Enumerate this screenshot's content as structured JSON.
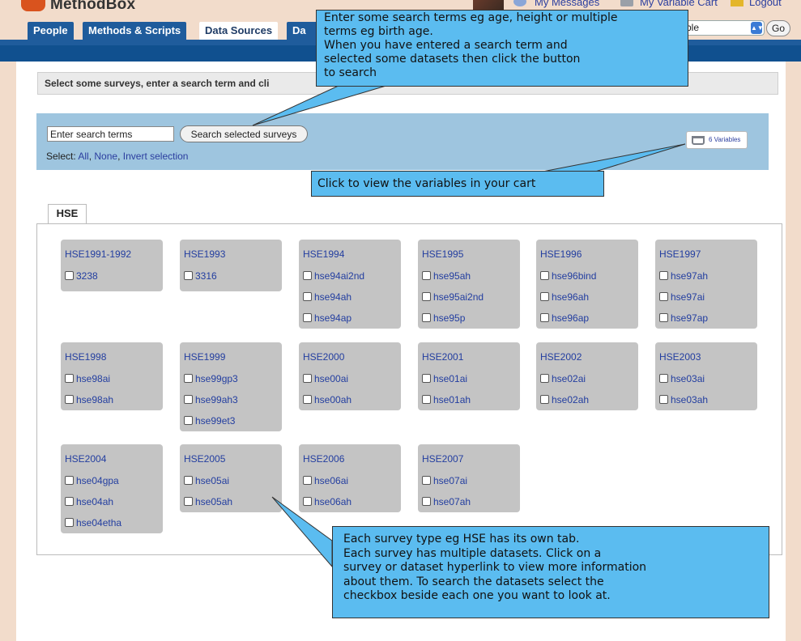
{
  "header": {
    "brand": "MethodBox",
    "links": {
      "messages": "My Messages",
      "variable_cart": "My Variable Cart",
      "logout": "Logout"
    },
    "nav_tabs": [
      {
        "label": "People"
      },
      {
        "label": "Methods & Scripts"
      },
      {
        "label": "Data Sources"
      },
      {
        "label": "Da"
      }
    ],
    "active_tab": "Data Sources",
    "search_scope_value": "ble",
    "go_label": "Go"
  },
  "content": {
    "instruction": "Select some surveys, enter a search term and cli",
    "search": {
      "value": "Enter search terms",
      "button_label": "Search selected surveys"
    },
    "select": {
      "prefix": "Select:",
      "all": "All",
      "sep1": ",",
      "none": "None",
      "sep2": ",",
      "invert": "Invert selection"
    },
    "cart_button_label": "6 Variables",
    "survey_tab": "HSE"
  },
  "surveys": [
    {
      "title": "HSE1991-1992",
      "datasets": [
        "3238"
      ]
    },
    {
      "title": "HSE1993",
      "datasets": [
        "3316"
      ]
    },
    {
      "title": "HSE1994",
      "datasets": [
        "hse94ai2nd",
        "hse94ah",
        "hse94ap"
      ]
    },
    {
      "title": "HSE1995",
      "datasets": [
        "hse95ah",
        "hse95ai2nd",
        "hse95p"
      ]
    },
    {
      "title": "HSE1996",
      "datasets": [
        "hse96bind",
        "hse96ah",
        "hse96ap"
      ]
    },
    {
      "title": "HSE1997",
      "datasets": [
        "hse97ah",
        "hse97ai",
        "hse97ap"
      ]
    },
    {
      "title": "HSE1998",
      "datasets": [
        "hse98ai",
        "hse98ah"
      ]
    },
    {
      "title": "HSE1999",
      "datasets": [
        "hse99gp3",
        "hse99ah3",
        "hse99et3"
      ]
    },
    {
      "title": "HSE2000",
      "datasets": [
        "hse00ai",
        "hse00ah"
      ]
    },
    {
      "title": "HSE2001",
      "datasets": [
        "hse01ai",
        "hse01ah"
      ]
    },
    {
      "title": "HSE2002",
      "datasets": [
        "hse02ai",
        "hse02ah"
      ]
    },
    {
      "title": "HSE2003",
      "datasets": [
        "hse03ai",
        "hse03ah"
      ]
    },
    {
      "title": "HSE2004",
      "datasets": [
        "hse04gpa",
        "hse04ah",
        "hse04etha"
      ]
    },
    {
      "title": "HSE2005",
      "datasets": [
        "hse05ai",
        "hse05ah"
      ]
    },
    {
      "title": "HSE2006",
      "datasets": [
        "hse06ai",
        "hse06ah"
      ]
    },
    {
      "title": "HSE2007",
      "datasets": [
        "hse07ai",
        "hse07ah"
      ]
    }
  ],
  "callouts": {
    "search": [
      "Enter some search terms eg age, height or multiple",
      "terms eg birth age.",
      "When you have entered a search term and",
      "selected some datasets then click the button",
      "to search"
    ],
    "cart": [
      "Click to view the variables in your cart"
    ],
    "tabs": [
      "Each survey type eg HSE has its own tab.",
      "Each survey has multiple datasets. Click on a",
      "survey or dataset hyperlink to view more information",
      "about them.  To search the datasets select the",
      "checkbox beside each one you want to look at."
    ]
  }
}
